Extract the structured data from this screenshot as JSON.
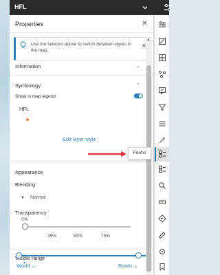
{
  "topbar": {
    "title": "HFL",
    "dropdown_icon": "chevron-down-icon",
    "settings_icon": "layer-settings-icon"
  },
  "panel": {
    "title": "Properties",
    "notice": "Use the selector above to switch between layers in the map.",
    "sections": {
      "information": "Information",
      "symbology": "Symbology",
      "appearance": "Appearance",
      "visible_range": "Visible range"
    },
    "symbology": {
      "legend_label": "Show in map legend",
      "legend_on": true,
      "layer_name": "HFL",
      "symbol_color": "#e0863a",
      "edit_link": "Edit layer style"
    },
    "appearance": {
      "blending_label": "Blending",
      "blending_value": "Normal",
      "transparency_label": "Transparency",
      "transparency_value": "0%",
      "ticks": [
        "25%",
        "50%",
        "75%"
      ]
    },
    "visible_range": {
      "min": "World",
      "max": "Room"
    }
  },
  "tooltip": {
    "label": "Forms"
  },
  "accent_color": "#2d7fb8",
  "annotation_arrow_color": "#d9363e"
}
